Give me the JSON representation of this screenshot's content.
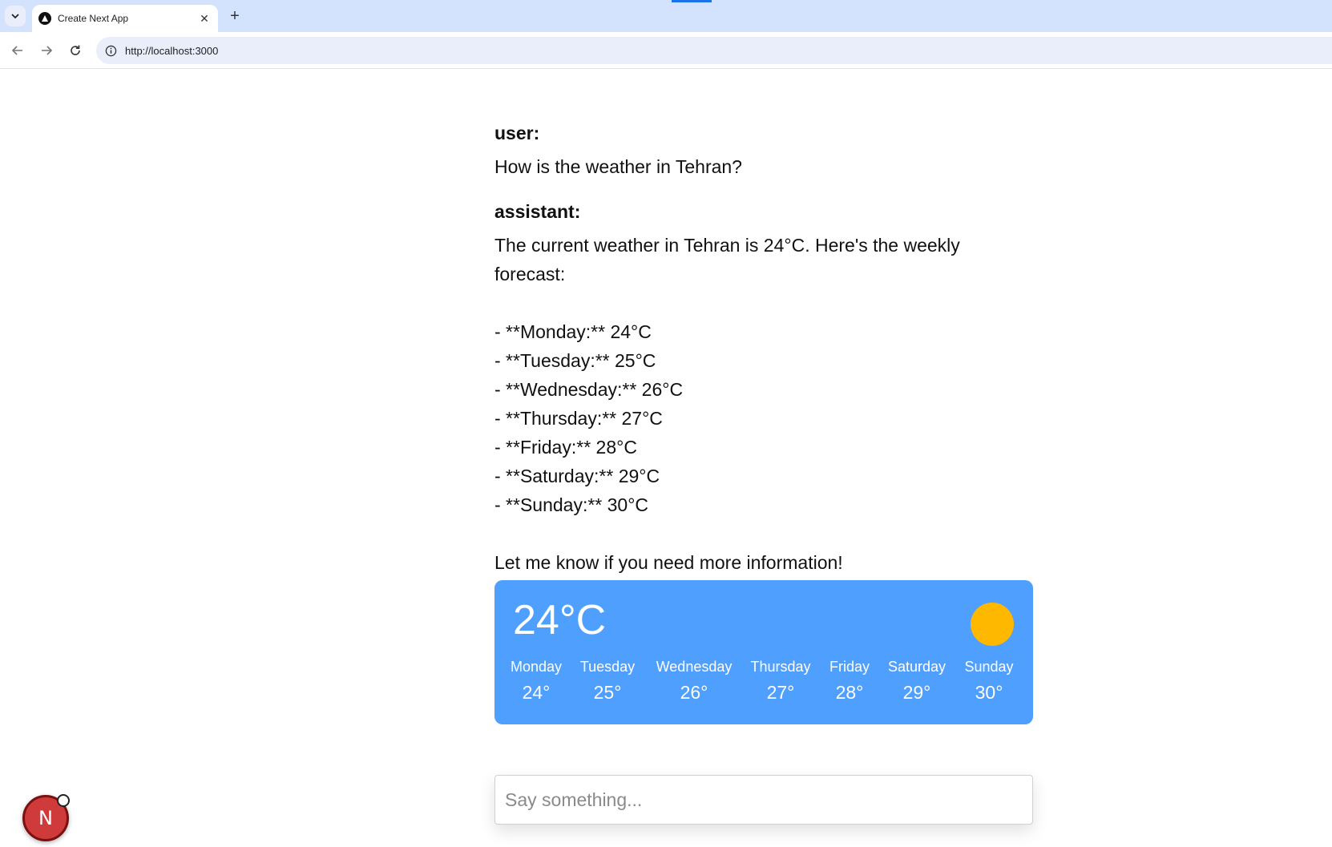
{
  "browser": {
    "tab_title": "Create Next App",
    "new_tab_label": "+",
    "close_label": "✕",
    "url": "http://localhost:3000"
  },
  "chat": {
    "messages": [
      {
        "role": "user:",
        "text": "How is the weather in Tehran?"
      },
      {
        "role": "assistant:",
        "text": "The current weather in Tehran is 24°C. Here's the weekly\nforecast:\n\n- **Monday:** 24°C\n- **Tuesday:** 25°C\n- **Wednesday:** 26°C\n- **Thursday:** 27°C\n- **Friday:** 28°C\n- **Saturday:** 29°C\n- **Sunday:** 30°C\n\nLet me know if you need more information!"
      }
    ]
  },
  "weather": {
    "current_temp": "24°C",
    "icon": "sun-icon",
    "forecast": [
      {
        "day": "Monday",
        "temp": "24°"
      },
      {
        "day": "Tuesday",
        "temp": "25°"
      },
      {
        "day": "Wednesday",
        "temp": "26°"
      },
      {
        "day": "Thursday",
        "temp": "27°"
      },
      {
        "day": "Friday",
        "temp": "28°"
      },
      {
        "day": "Saturday",
        "temp": "29°"
      },
      {
        "day": "Sunday",
        "temp": "30°"
      }
    ],
    "colors": {
      "card": "#4f9ffe",
      "sun": "#ffb800"
    }
  },
  "input": {
    "placeholder": "Say something..."
  },
  "dev_badge": {
    "letter": "N"
  }
}
